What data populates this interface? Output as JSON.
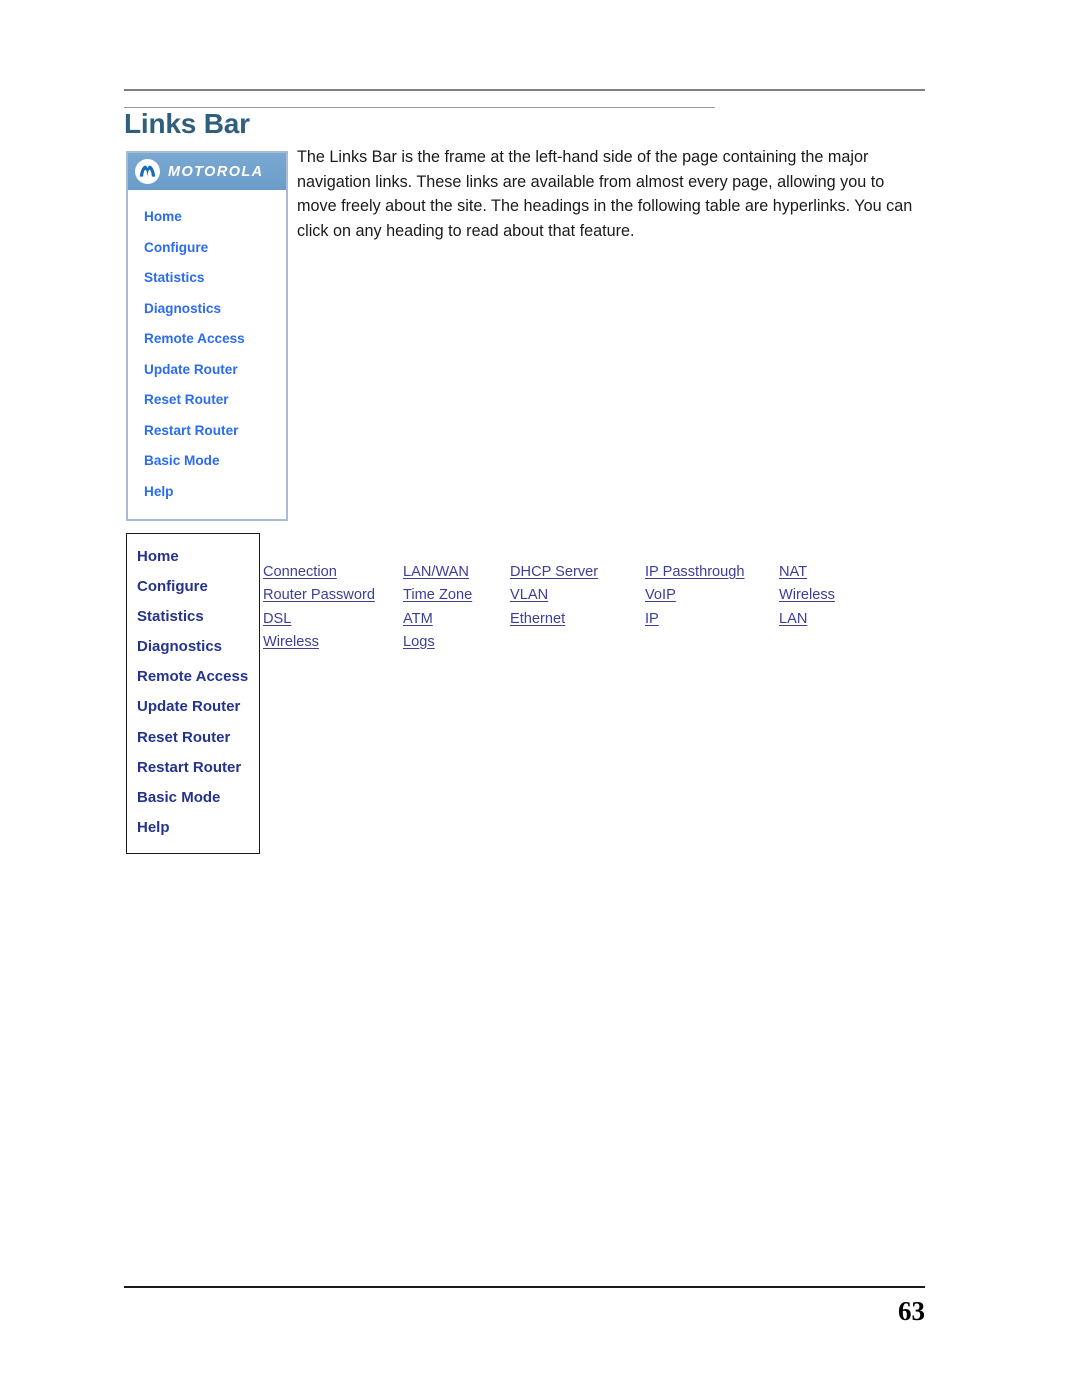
{
  "page": {
    "title": "Links Bar",
    "number": "63",
    "intro": "The Links Bar is the frame at the left-hand side of the page containing the major navigation links. These links are available from almost every page, allowing you to move freely about the site. The headings in the following table are hyperlinks. You can click on any heading to read about that feature."
  },
  "links_bar_screenshot": {
    "brand": "MOTOROLA",
    "items": [
      {
        "label": "Home"
      },
      {
        "label": "Configure"
      },
      {
        "label": "Statistics"
      },
      {
        "label": "Diagnostics"
      },
      {
        "label": "Remote Access"
      },
      {
        "label": "Update Router"
      },
      {
        "label": "Reset Router"
      },
      {
        "label": "Restart Router"
      },
      {
        "label": "Basic Mode"
      },
      {
        "label": "Help"
      }
    ]
  },
  "reference_table": {
    "headings": [
      {
        "label": "Home"
      },
      {
        "label": "Configure"
      },
      {
        "label": "Statistics"
      },
      {
        "label": "Diagnostics"
      },
      {
        "label": "Remote Access"
      },
      {
        "label": "Update Router"
      },
      {
        "label": "Reset Router"
      },
      {
        "label": "Restart Router"
      },
      {
        "label": "Basic Mode"
      },
      {
        "label": "Help"
      }
    ],
    "rows": [
      [
        "Connection",
        "LAN/WAN",
        "DHCP Server",
        "IP Passthrough",
        "NAT"
      ],
      [
        "Router Password",
        "Time Zone",
        "VLAN",
        "VoIP",
        "Wireless"
      ],
      [
        "DSL",
        "ATM",
        "Ethernet",
        "IP",
        "LAN"
      ],
      [
        "Wireless",
        "Logs",
        "",
        "",
        ""
      ]
    ]
  }
}
